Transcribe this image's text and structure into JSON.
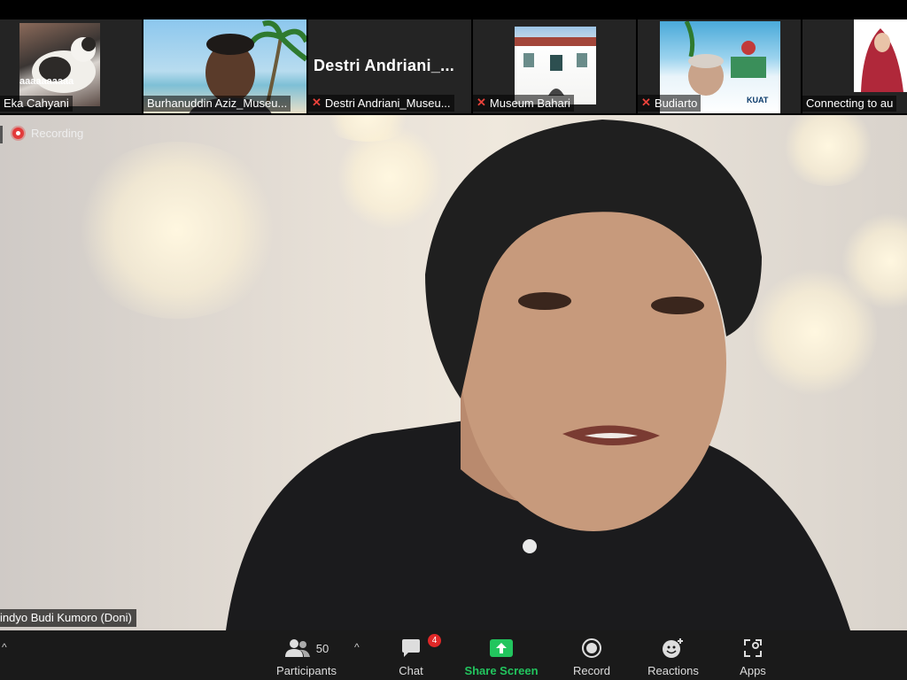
{
  "gallery": [
    {
      "name": "Eka Cahyani",
      "overlay_text": "aaaaaaaaaa",
      "muted": false
    },
    {
      "name": "Burhanuddin Aziz_Museu...",
      "muted": false
    },
    {
      "name": "Destri Andriani_Museu...",
      "display_name": "Destri  Andriani_...",
      "muted": true
    },
    {
      "name": "Museum Bahari",
      "muted": true
    },
    {
      "name": "Budiarto",
      "muted": true,
      "overlay_text": "KUAT"
    },
    {
      "name": "Connecting to au",
      "muted": false
    }
  ],
  "recording": {
    "label": "Recording"
  },
  "speaker": {
    "name": "indyo Budi Kumoro (Doni)"
  },
  "toolbar": {
    "participants_label": "Participants",
    "participants_count": "50",
    "chat_label": "Chat",
    "chat_badge": "4",
    "share_label": "Share Screen",
    "record_label": "Record",
    "reactions_label": "Reactions",
    "apps_label": "Apps",
    "caret": "^"
  },
  "colors": {
    "share_green": "#22c55e",
    "record_red": "#e23b3b",
    "muted_red": "#e8423b",
    "badge_red": "#e02828",
    "toolbar_bg": "#1a1a1a"
  }
}
